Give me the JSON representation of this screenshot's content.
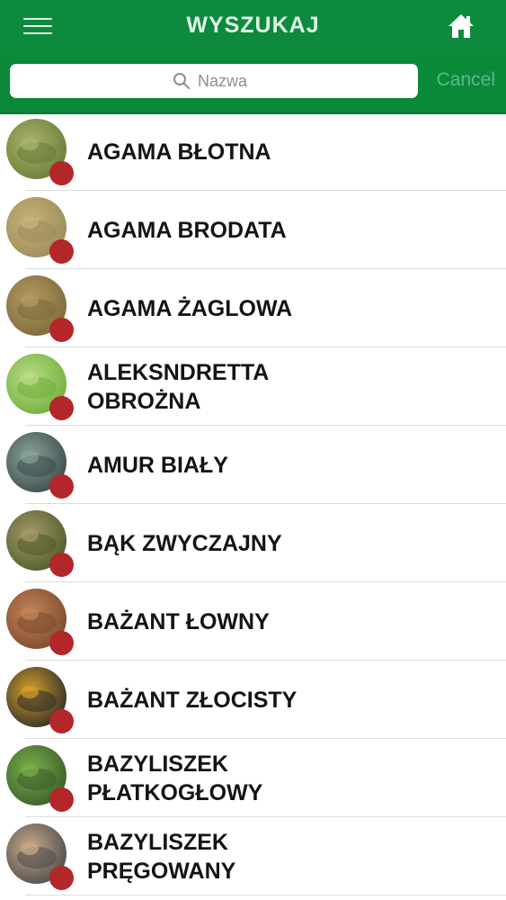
{
  "header": {
    "title": "WYSZUKAJ",
    "menu_icon": "hamburger-menu-icon",
    "home_icon": "home-icon",
    "bar_color": "#0d8a3d"
  },
  "search": {
    "placeholder": "Nazwa",
    "value": "",
    "icon": "search-icon",
    "cancel_label": "Cancel"
  },
  "badge_color": "#b3262a",
  "species": [
    {
      "name": "AGAMA BŁOTNA",
      "thumb_colors": [
        "#6b7a3a",
        "#a8b56a"
      ]
    },
    {
      "name": "AGAMA BRODATA",
      "thumb_colors": [
        "#9a8a5a",
        "#c9b27a"
      ]
    },
    {
      "name": "AGAMA ŻAGLOWA",
      "thumb_colors": [
        "#7a6a3a",
        "#b59a62"
      ]
    },
    {
      "name": "ALEKSNDRETTA\nOBROŻNA",
      "thumb_colors": [
        "#6fae3a",
        "#b9dc86"
      ]
    },
    {
      "name": "AMUR BIAŁY",
      "thumb_colors": [
        "#3a4a4a",
        "#8aa39a"
      ]
    },
    {
      "name": "BĄK ZWYCZAJNY",
      "thumb_colors": [
        "#4e5a2a",
        "#a59a6a"
      ]
    },
    {
      "name": "BAŻANT ŁOWNY",
      "thumb_colors": [
        "#7a4a2a",
        "#c4845a"
      ]
    },
    {
      "name": "BAŻANT ZŁOCISTY",
      "thumb_colors": [
        "#2a2a2a",
        "#d4a02a"
      ]
    },
    {
      "name": "BAZYLISZEK\nPŁATKOGŁOWY",
      "thumb_colors": [
        "#3a5a2a",
        "#7ab04a"
      ]
    },
    {
      "name": "BAZYLISZEK\nPRĘGOWANY",
      "thumb_colors": [
        "#4a4a4a",
        "#c9a98a"
      ]
    }
  ]
}
